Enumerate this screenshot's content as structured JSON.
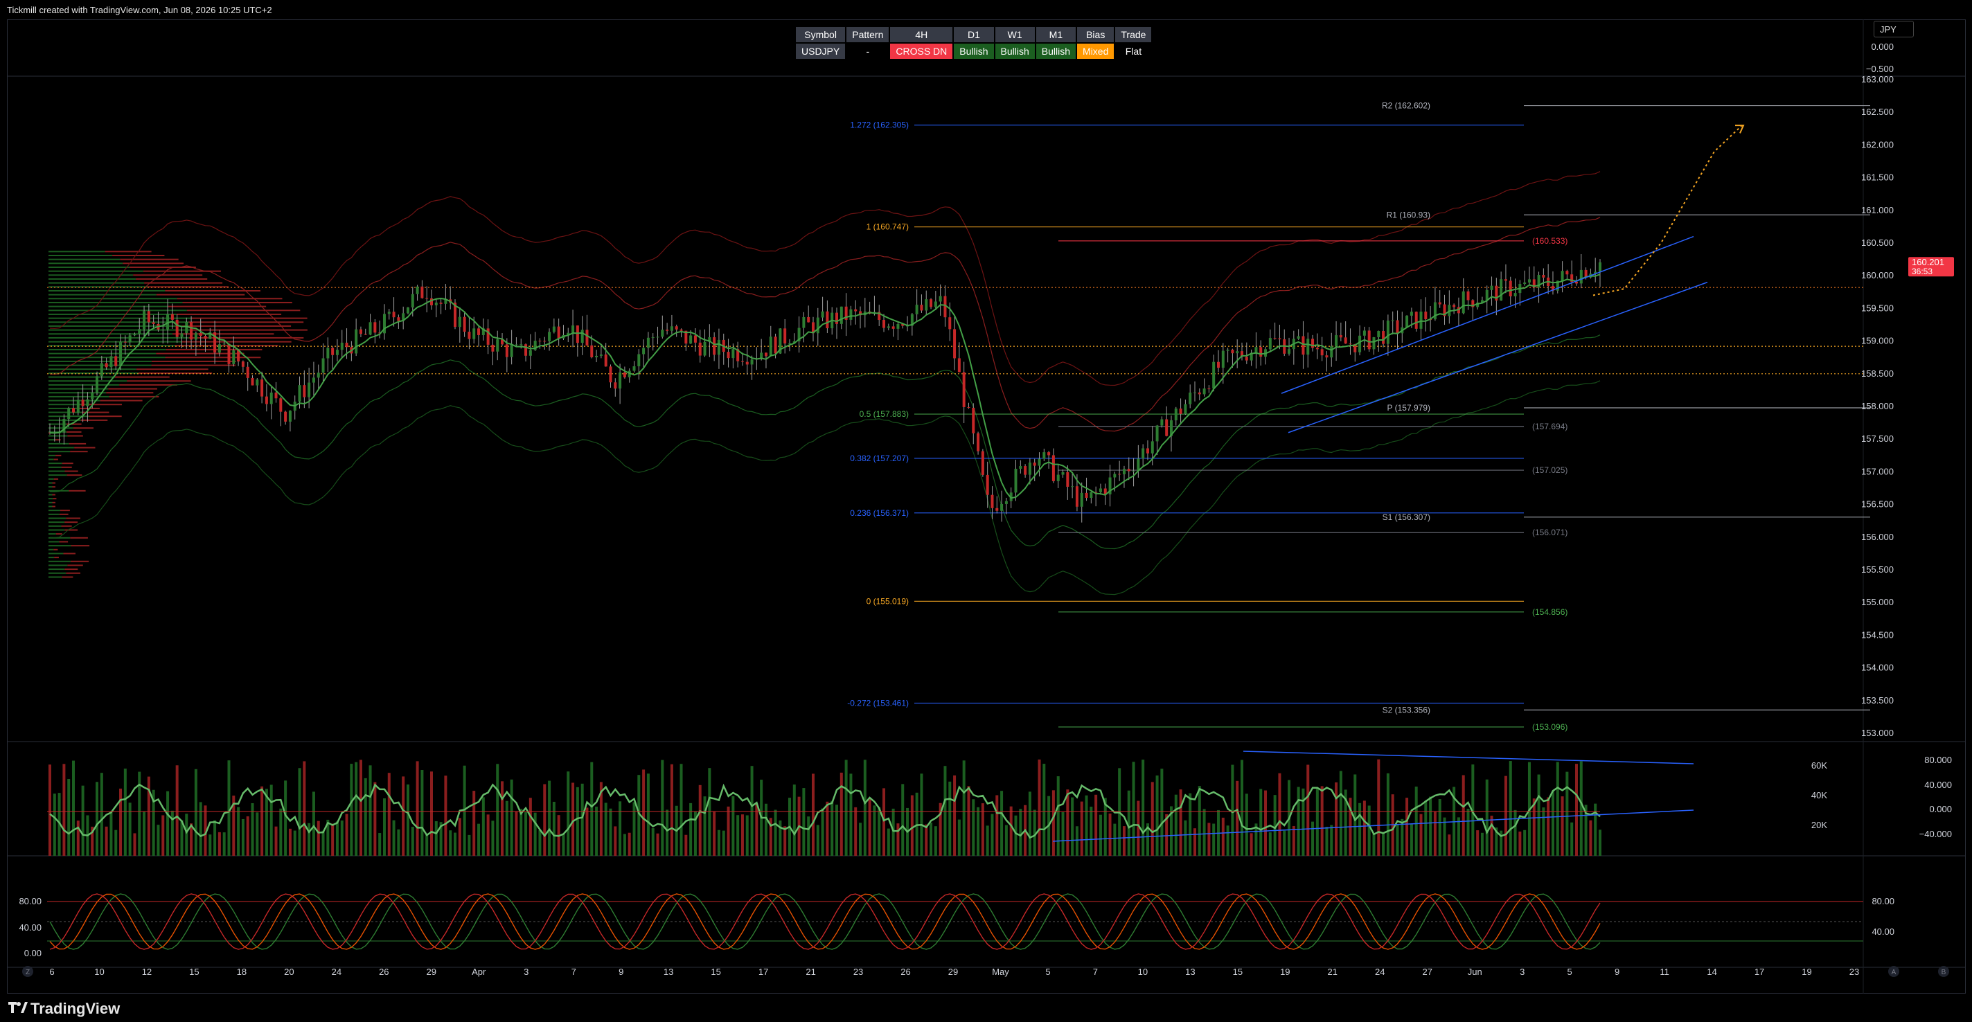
{
  "header": {
    "caption": "Tickmill created with TradingView.com, Jun 08, 2026 10:25 UTC+2"
  },
  "currency": "JPY",
  "status_table": {
    "headers": [
      "Symbol",
      "Pattern",
      "4H",
      "D1",
      "W1",
      "M1",
      "Bias",
      "Trade"
    ],
    "values": [
      "USDJPY",
      "-",
      "CROSS DN",
      "Bullish",
      "Bullish",
      "Bullish",
      "Mixed",
      "Flat"
    ],
    "value_colors": [
      "#363a45",
      "#000000",
      "#f23645",
      "#1b5e20",
      "#1b5e20",
      "#1b5e20",
      "#ff9800",
      "#000000"
    ]
  },
  "colors": {
    "up": "#26a69a",
    "green": "#2e7d32",
    "down": "#f23645",
    "fib_gold": "#f5a623",
    "fib_blue": "#2962ff",
    "line": "#b2b5be"
  },
  "price_axis": {
    "ticks": [
      "163.000",
      "162.500",
      "162.000",
      "161.500",
      "161.000",
      "160.500",
      "160.000",
      "159.500",
      "159.000",
      "158.500",
      "158.000",
      "157.500",
      "157.000",
      "156.500",
      "156.000",
      "155.500",
      "155.000",
      "154.500",
      "154.000",
      "153.500",
      "153.000"
    ]
  },
  "top_axis": {
    "ticks": [
      "0.000",
      "−0.500"
    ]
  },
  "last_price": {
    "value": "160.201",
    "countdown": "36:53"
  },
  "volume_axis": {
    "left_ticks": [
      "60K",
      "40K",
      "20K"
    ],
    "right_ticks": [
      "80.000",
      "40.000",
      "0.000",
      "−40.000"
    ]
  },
  "stoch_axis": {
    "left_ticks": [
      "80.00",
      "40.00",
      "0.00"
    ],
    "right_ticks": [
      "80.00",
      "40.00"
    ]
  },
  "time_axis": {
    "labels": [
      "6",
      "10",
      "12",
      "15",
      "18",
      "20",
      "24",
      "26",
      "29",
      "Apr",
      "3",
      "7",
      "9",
      "13",
      "15",
      "17",
      "21",
      "23",
      "26",
      "29",
      "May",
      "5",
      "7",
      "10",
      "13",
      "15",
      "19",
      "21",
      "24",
      "27",
      "Jun",
      "3",
      "5",
      "9",
      "11",
      "14",
      "17",
      "19",
      "23"
    ],
    "corner_left": "Z",
    "corner_right_a": "A",
    "corner_right_b": "B"
  },
  "levels": [
    {
      "label": "R2 (162.602)",
      "price": 162.602,
      "color": "#b2b5be"
    },
    {
      "label": "1.272 (162.305)",
      "price": 162.305,
      "color": "#2962ff"
    },
    {
      "label": "R1 (160.93)",
      "price": 160.93,
      "color": "#b2b5be"
    },
    {
      "label": "1 (160.747)",
      "price": 160.747,
      "color": "#f5a623"
    },
    {
      "label": "(160.533)",
      "price": 160.533,
      "color": "#f23645"
    },
    {
      "label": "P (157.979)",
      "price": 157.979,
      "color": "#b2b5be"
    },
    {
      "label": "0.5 (157.883)",
      "price": 157.883,
      "color": "#4caf50"
    },
    {
      "label": "(157.694)",
      "price": 157.694,
      "color": "#787b86"
    },
    {
      "label": "0.382 (157.207)",
      "price": 157.207,
      "color": "#2962ff"
    },
    {
      "label": "(157.025)",
      "price": 157.025,
      "color": "#787b86"
    },
    {
      "label": "0.236 (156.371)",
      "price": 156.371,
      "color": "#2962ff"
    },
    {
      "label": "S1 (156.307)",
      "price": 156.307,
      "color": "#b2b5be"
    },
    {
      "label": "(156.071)",
      "price": 156.071,
      "color": "#787b86"
    },
    {
      "label": "0 (155.019)",
      "price": 155.019,
      "color": "#f5a623"
    },
    {
      "label": "(154.856)",
      "price": 154.856,
      "color": "#4caf50"
    },
    {
      "label": "-0.272 (153.461)",
      "price": 153.461,
      "color": "#2962ff"
    },
    {
      "label": "S2 (153.356)",
      "price": 153.356,
      "color": "#b2b5be"
    },
    {
      "label": "(153.096)",
      "price": 153.096,
      "color": "#4caf50"
    }
  ],
  "chart_data": {
    "type": "line",
    "symbol": "USDJPY",
    "timeframe": "4H",
    "x": [
      "Mar 6",
      "Mar 10",
      "Mar 12",
      "Mar 15",
      "Mar 18",
      "Mar 20",
      "Mar 24",
      "Mar 26",
      "Mar 29",
      "Apr 1",
      "Apr 3",
      "Apr 7",
      "Apr 9",
      "Apr 13",
      "Apr 15",
      "Apr 17",
      "Apr 21",
      "Apr 23",
      "Apr 26",
      "Apr 29",
      "May 1",
      "May 5",
      "May 7",
      "May 10",
      "May 13",
      "May 15",
      "May 19",
      "May 21",
      "May 24",
      "May 27",
      "Jun 1",
      "Jun 3",
      "Jun 5",
      "Jun 8"
    ],
    "series": [
      {
        "name": "USDJPY",
        "values": [
          157.6,
          158.4,
          159.3,
          159.2,
          158.7,
          157.9,
          158.8,
          159.2,
          159.8,
          159.1,
          158.8,
          159.3,
          158.4,
          159.2,
          158.9,
          158.8,
          159.2,
          159.4,
          159.3,
          159.6,
          156.4,
          157.3,
          156.5,
          157.1,
          157.9,
          158.7,
          159.0,
          158.9,
          159.0,
          159.3,
          159.6,
          159.8,
          159.9,
          160.2
        ]
      }
    ],
    "ylim": [
      153.0,
      163.0
    ]
  }
}
